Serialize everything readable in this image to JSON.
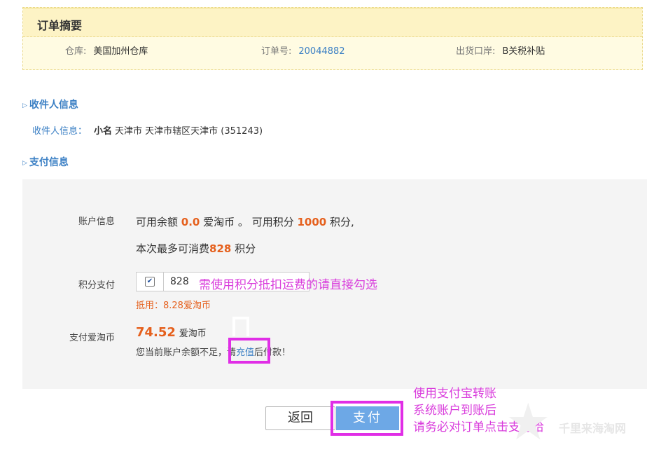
{
  "summary": {
    "title": "订单摘要",
    "warehouse_label": "仓库:",
    "warehouse_value": "美国加州仓库",
    "order_label": "订单号:",
    "order_value": "20044882",
    "port_label": "出货口岸:",
    "port_value": "B关税补贴"
  },
  "receiver": {
    "section_title": "收件人信息",
    "label": "收件人信息：",
    "name": "小名",
    "address": "天津市 天津市辖区天津市 (351243)"
  },
  "payment": {
    "section_title": "支付信息",
    "account_label": "账户信息",
    "balance_prefix": "可用余额",
    "balance_value": "0.0",
    "balance_suffix": "爱淘币 。 可用积分",
    "points_value": "1000",
    "points_suffix": "积分,",
    "max_prefix": "本次最多可消费",
    "max_value": "828",
    "max_suffix": "积分",
    "points_pay_label": "积分支付",
    "points_input_value": "828",
    "checkbox_checked": true,
    "deduct_text": "抵用：8.28爱淘币",
    "pay_coin_label": "支付爱淘币",
    "pay_amount": "74.52",
    "pay_unit": "爱淘币",
    "insufficient_prefix": "您当前账户余额不足，请",
    "recharge_link": "充值",
    "insufficient_suffix": "后付款！"
  },
  "annotations": {
    "points_tip": "需使用积分抵扣运费的请直接勾选",
    "alipay_line1": "使用支付宝转账",
    "alipay_line2": "系统账户到账后",
    "alipay_line3": "请务必对订单点击支付哈"
  },
  "buttons": {
    "back_label": "返回",
    "pay_label": "支付"
  },
  "watermark_text": "千里来海淘网",
  "colors": {
    "link": "#3a7fc4",
    "orange": "#e5601d",
    "annotation": "#d93ddc",
    "pay_button": "#6da8e6"
  }
}
